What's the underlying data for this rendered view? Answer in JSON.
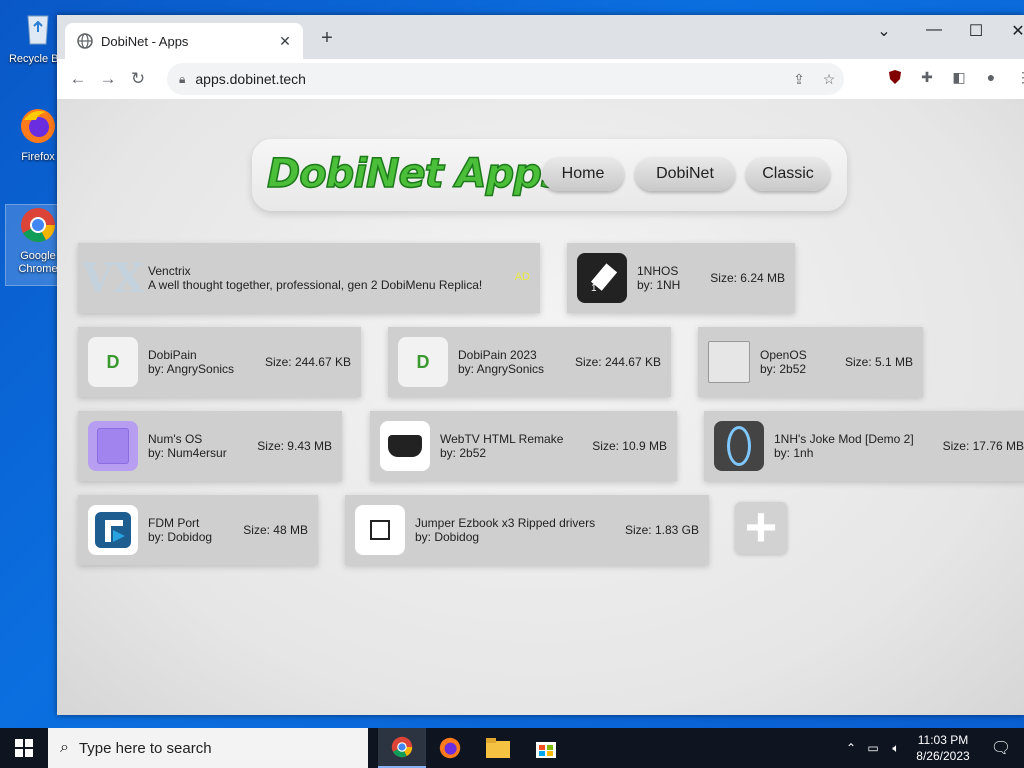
{
  "desktop": {
    "icons": [
      {
        "label": "Recycle Bin"
      },
      {
        "label": "Firefox"
      },
      {
        "label": "Google Chrome"
      }
    ]
  },
  "browser": {
    "tab_title": "DobiNet - Apps",
    "new_tab": "+",
    "url": "apps.dobinet.tech"
  },
  "site": {
    "logo": "DobiNet Apps",
    "nav": [
      "Home",
      "DobiNet",
      "Classic"
    ],
    "apps": [
      {
        "name": "Venctrix",
        "subtitle": "A well thought together, professional, gen 2 DobiMenu Replica!",
        "badge": "AD",
        "icon": "vx-logo-icon"
      },
      {
        "name": "1NHOS",
        "subtitle": "by: 1NH",
        "size": "Size: 6.24 MB",
        "icon": "1nhos-icon"
      },
      {
        "name": "DobiPain",
        "subtitle": "by: AngrySonics",
        "size": "Size: 244.67 KB",
        "icon": "dobipain-icon"
      },
      {
        "name": "DobiPain 2023",
        "subtitle": "by: AngrySonics",
        "size": "Size: 244.67 KB",
        "icon": "dobipain-icon"
      },
      {
        "name": "OpenOS",
        "subtitle": "by: 2b52",
        "size": "Size: 5.1 MB",
        "icon": "folder-icon"
      },
      {
        "name": "Num's OS",
        "subtitle": "by: Num4ersur",
        "size": "Size: 9.43 MB",
        "icon": "numsos-icon"
      },
      {
        "name": "WebTV HTML Remake",
        "subtitle": "by: 2b52",
        "size": "Size: 10.9 MB",
        "icon": "webtv-icon"
      },
      {
        "name": "1NH's Joke Mod [Demo 2]",
        "subtitle": "by: 1nh",
        "size": "Size: 17.76 MB",
        "icon": "portal-icon"
      },
      {
        "name": "FDM Port",
        "subtitle": "by: Dobidog",
        "size": "Size: 48 MB",
        "icon": "fdm-icon"
      },
      {
        "name": "Jumper Ezbook x3 Ripped drivers",
        "subtitle": "by: Dobidog",
        "size": "Size: 1.83 GB",
        "icon": "drivers-icon"
      }
    ],
    "add_button": "+"
  },
  "taskbar": {
    "search_placeholder": "Type here to search",
    "time": "11:03 PM",
    "date": "8/26/2023"
  },
  "colors": {
    "desktop": "#0b6fe0",
    "logo_green": "#4cbf3a",
    "card": "#cfcfcf",
    "taskbar": "#0e1521"
  }
}
